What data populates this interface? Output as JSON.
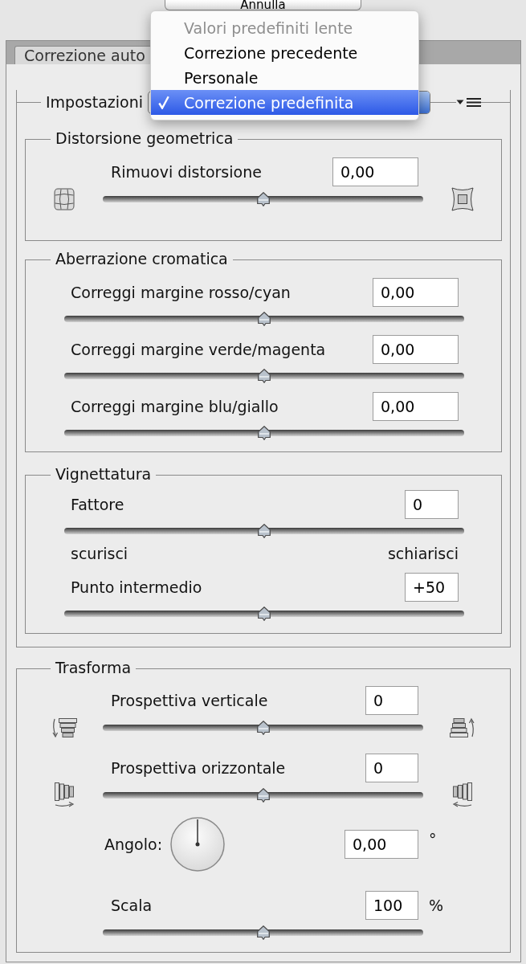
{
  "cancel_button": {
    "label": "Annulla"
  },
  "tabs": [
    {
      "label": "Correzione auto"
    }
  ],
  "preset_menu": {
    "items": [
      {
        "label": "Valori predefiniti lente",
        "disabled": true,
        "selected": false
      },
      {
        "label": "Correzione precedente",
        "disabled": false,
        "selected": false
      },
      {
        "label": "Personale",
        "disabled": false,
        "selected": false
      },
      {
        "label": "Correzione predefinita",
        "disabled": false,
        "selected": true
      }
    ]
  },
  "settings": {
    "label": "Impostazioni",
    "sections": [
      {
        "title": "Distorsione geometrica",
        "controls": [
          {
            "kind": "icon_slider",
            "label": "Rimuovi distorsione",
            "value": "0,00",
            "level": 0.5
          }
        ]
      },
      {
        "title": "Aberrazione cromatica",
        "controls": [
          {
            "kind": "slider",
            "label": "Correggi margine rosso/cyan",
            "value": "0,00",
            "level": 0.5
          },
          {
            "kind": "slider",
            "label": "Correggi margine verde/magenta",
            "value": "0,00",
            "level": 0.5
          },
          {
            "kind": "slider",
            "label": "Correggi margine blu/giallo",
            "value": "0,00",
            "level": 0.5
          }
        ]
      },
      {
        "title": "Vignettatura",
        "controls": [
          {
            "kind": "slider",
            "label": "Fattore",
            "value": "0",
            "level": 0.5,
            "min_label": "scurisci",
            "max_label": "schiarisci"
          },
          {
            "kind": "slider",
            "label": "Punto intermedio",
            "value": "+50",
            "level": 0.5
          }
        ]
      }
    ]
  },
  "transform": {
    "title": "Trasforma",
    "controls": [
      {
        "kind": "icon_slider",
        "label": "Prospettiva verticale",
        "value": "0",
        "level": 0.5
      },
      {
        "kind": "icon_slider",
        "label": "Prospettiva orizzontale",
        "value": "0",
        "level": 0.5
      },
      {
        "kind": "dial",
        "label": "Angolo:",
        "value": "0,00",
        "unit": "°"
      },
      {
        "kind": "inset_slider",
        "label": "Scala",
        "value": "100",
        "unit": "%",
        "level": 0.5
      }
    ]
  }
}
